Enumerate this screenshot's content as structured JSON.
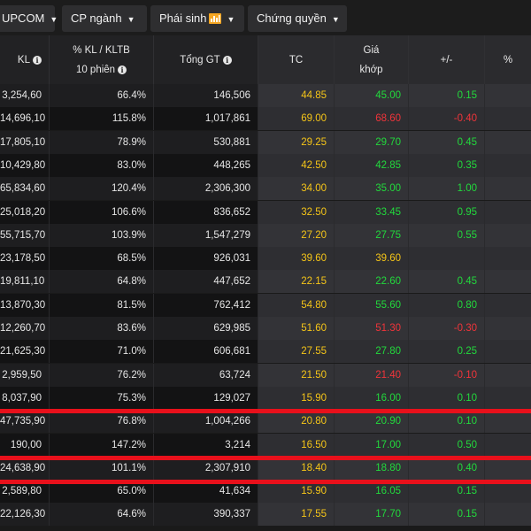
{
  "tabs": [
    {
      "label": "UPCOM",
      "caret": "▼"
    },
    {
      "label": "CP ngành",
      "caret": "▼"
    },
    {
      "label": "Phái sinh",
      "caret": "▼",
      "icon": "bar-chart-icon"
    },
    {
      "label": "Chứng quyền",
      "caret": "▼"
    }
  ],
  "headers": {
    "kl": "KL",
    "pct_line1": "% KL / KLTB",
    "pct_line2": "10 phiên",
    "gt": "Tổng GT",
    "tc": "TC",
    "gia_line1": "Giá",
    "gia_line2": "khớp",
    "chg": "+/-",
    "pc": "%"
  },
  "colors": {
    "up": "#22d93c",
    "down": "#f0343a",
    "reference": "#f5c518",
    "highlight_lines": "#e8101b"
  },
  "rows": [
    {
      "kl": "3,254,60",
      "pct": "66.4%",
      "gt": "146,506",
      "tc": "44.85",
      "gia": "45.00",
      "chg": "0.15",
      "dir": "up"
    },
    {
      "kl": "14,696,10",
      "pct": "115.8%",
      "gt": "1,017,861",
      "tc": "69.00",
      "gia": "68.60",
      "chg": "-0.40",
      "dir": "down"
    },
    {
      "kl": "17,805,10",
      "pct": "78.9%",
      "gt": "530,881",
      "tc": "29.25",
      "gia": "29.70",
      "chg": "0.45",
      "dir": "up"
    },
    {
      "kl": "10,429,80",
      "pct": "83.0%",
      "gt": "448,265",
      "tc": "42.50",
      "gia": "42.85",
      "chg": "0.35",
      "dir": "up"
    },
    {
      "kl": "65,834,60",
      "pct": "120.4%",
      "gt": "2,306,300",
      "tc": "34.00",
      "gia": "35.00",
      "chg": "1.00",
      "dir": "up"
    },
    {
      "kl": "25,018,20",
      "pct": "106.6%",
      "gt": "836,652",
      "tc": "32.50",
      "gia": "33.45",
      "chg": "0.95",
      "dir": "up"
    },
    {
      "kl": "55,715,70",
      "pct": "103.9%",
      "gt": "1,547,279",
      "tc": "27.20",
      "gia": "27.75",
      "chg": "0.55",
      "dir": "up"
    },
    {
      "kl": "23,178,50",
      "pct": "68.5%",
      "gt": "926,031",
      "tc": "39.60",
      "gia": "39.60",
      "chg": "",
      "dir": "ref"
    },
    {
      "kl": "19,811,10",
      "pct": "64.8%",
      "gt": "447,652",
      "tc": "22.15",
      "gia": "22.60",
      "chg": "0.45",
      "dir": "up"
    },
    {
      "kl": "13,870,30",
      "pct": "81.5%",
      "gt": "762,412",
      "tc": "54.80",
      "gia": "55.60",
      "chg": "0.80",
      "dir": "up"
    },
    {
      "kl": "12,260,70",
      "pct": "83.6%",
      "gt": "629,985",
      "tc": "51.60",
      "gia": "51.30",
      "chg": "-0.30",
      "dir": "down"
    },
    {
      "kl": "21,625,30",
      "pct": "71.0%",
      "gt": "606,681",
      "tc": "27.55",
      "gia": "27.80",
      "chg": "0.25",
      "dir": "up"
    },
    {
      "kl": "2,959,50",
      "pct": "76.2%",
      "gt": "63,724",
      "tc": "21.50",
      "gia": "21.40",
      "chg": "-0.10",
      "dir": "down"
    },
    {
      "kl": "8,037,90",
      "pct": "75.3%",
      "gt": "129,027",
      "tc": "15.90",
      "gia": "16.00",
      "chg": "0.10",
      "dir": "up"
    },
    {
      "kl": "47,735,90",
      "pct": "76.8%",
      "gt": "1,004,266",
      "tc": "20.80",
      "gia": "20.90",
      "chg": "0.10",
      "dir": "up"
    },
    {
      "kl": "190,00",
      "pct": "147.2%",
      "gt": "3,214",
      "tc": "16.50",
      "gia": "17.00",
      "chg": "0.50",
      "dir": "up"
    },
    {
      "kl": "24,638,90",
      "pct": "101.1%",
      "gt": "2,307,910",
      "tc": "18.40",
      "gia": "18.80",
      "chg": "0.40",
      "dir": "up"
    },
    {
      "kl": "2,589,80",
      "pct": "65.0%",
      "gt": "41,634",
      "tc": "15.90",
      "gia": "16.05",
      "chg": "0.15",
      "dir": "up"
    },
    {
      "kl": "22,126,30",
      "pct": "64.6%",
      "gt": "390,337",
      "tc": "17.55",
      "gia": "17.70",
      "chg": "0.15",
      "dir": "up"
    }
  ]
}
